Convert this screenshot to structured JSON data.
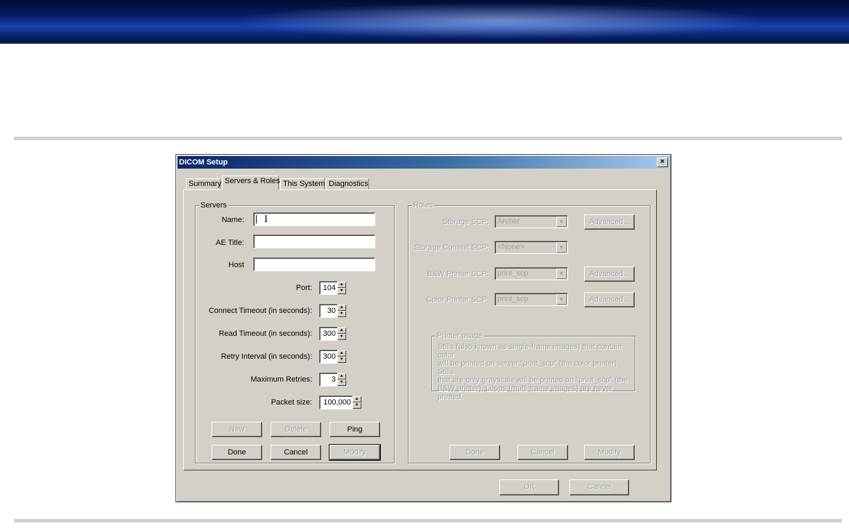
{
  "dialog": {
    "title": "DICOM Setup",
    "close_glyph": "×",
    "tabs": [
      {
        "label": "Summary"
      },
      {
        "label": "Servers & Roles"
      },
      {
        "label": "This System"
      },
      {
        "label": "Diagnostics"
      }
    ],
    "active_tab": "Servers & Roles",
    "ok_label": "OK",
    "cancel_label": "Cancel"
  },
  "servers": {
    "legend": "Servers",
    "name_label": "Name:",
    "name_value": "",
    "ae_title_label": "AE Title:",
    "ae_title_value": "",
    "host_label": "Host",
    "host_value": "",
    "port_label": "Port:",
    "port_value": "104",
    "connect_timeout_label": "Connect Timeout (in seconds):",
    "connect_timeout_value": "30",
    "read_timeout_label": "Read Timeout (in seconds):",
    "read_timeout_value": "300",
    "retry_interval_label": "Retry Interval (in seconds):",
    "retry_interval_value": "300",
    "max_retries_label": "Maximum Retries:",
    "max_retries_value": "3",
    "packet_size_label": "Packet size:",
    "packet_size_value": "100,000",
    "buttons": {
      "new": "New",
      "delete": "Delete",
      "ping": "Ping",
      "done": "Done",
      "cancel": "Cancel",
      "modify": "Modify"
    }
  },
  "roles": {
    "legend": "Roles",
    "storage_scp_label": "Storage SCP:",
    "storage_scp_value": "Archer",
    "storage_commit_scp_label": "Storage Commit SCP:",
    "storage_commit_scp_value": "<None>",
    "bw_printer_scp_label": "B&W Printer SCP:",
    "bw_printer_scp_value": "print_scp",
    "color_printer_scp_label": "Color Printer SCP:",
    "color_printer_scp_value": "print_scp",
    "advanced_label": "Advanced...",
    "printer_usage_legend": "Printer usage",
    "printer_usage_lines": [
      "Stills (also known as single-frame images) that contain color",
      "will be printed on server \"print_scp\" (the color printer). Stills",
      "that are only grayscale will be printed on \"print_scp\" (the",
      "B&W printer). Loops (multi-frame images) are never printed."
    ],
    "buttons": {
      "done": "Done",
      "cancel": "Cancel",
      "modify": "Modify"
    }
  },
  "colors": {
    "dialog_face": "#d4d0c8",
    "titlebar_start": "#0a246a",
    "titlebar_end": "#a6caf0",
    "disabled_text": "#a0a0a0"
  }
}
